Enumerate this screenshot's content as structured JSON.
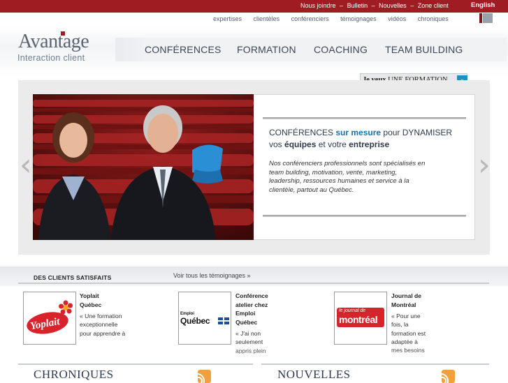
{
  "topbar": {
    "links": [
      "Nous joindre",
      "Bulletin",
      "Nouvelles",
      "Zone client"
    ],
    "separator": "–",
    "language": "English"
  },
  "sublinks": [
    "expertises",
    "clientèles",
    "conférenciers",
    "témoignages",
    "vidéos",
    "chroniques"
  ],
  "logo": {
    "main": "Avantage",
    "sub": "Interaction client"
  },
  "nav": [
    "CONFÉRENCES",
    "FORMATION",
    "COACHING",
    "TEAM BUILDING"
  ],
  "cta": {
    "prefix": "Je veux",
    "label": "UNE FORMATION",
    "arrow": "»"
  },
  "hero": {
    "head_1": "CONFÉRENCES",
    "head_2": "sur mesure",
    "head_3": "pour DYNAMISER",
    "head_4": "vos",
    "head_5": "équipes",
    "head_6": "et votre",
    "head_7": "entreprise",
    "body": "Nos conférenciers professionnels sont spécialisés en team building, motivation, vente, marketing, leadership, ressources humaines et service à la clientèle, partout au Québec.",
    "prev": "‹",
    "next": "›"
  },
  "clients": {
    "title": "DES CLIENTS SATISFAITS",
    "all_link": "Voir tous les témoignages  »",
    "items": [
      {
        "name": "Yoplait Québec",
        "logo_text": "Yoplait",
        "quote": "« Une formation exceptionnelle pour apprendre à"
      },
      {
        "name": "Conférence atelier chez Emploi Québec",
        "logo_small": "Emploi",
        "logo_text": "Québec",
        "quote": "« J'ai non seulement appris plein"
      },
      {
        "name": "Journal de Montréal",
        "logo_top": "le journal de",
        "logo_text": "montréal",
        "quote": "« Pour une fois, la formation est adaptée à mes besoins"
      }
    ]
  },
  "bottom": {
    "left_title": "CHRONIQUES",
    "right_title": "NOUVELLES"
  },
  "colors": {
    "brand_red": "#9f1d22",
    "accent_blue": "#1d8fc2",
    "text_dark": "#2e3a4e"
  }
}
